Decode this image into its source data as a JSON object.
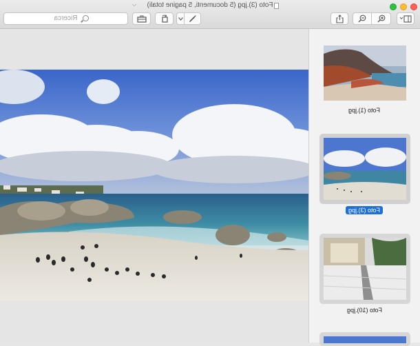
{
  "window": {
    "title": "Foto (3).jpg (5 documenti, 5 pagine totali)"
  },
  "toolbar": {
    "search_placeholder": "Ricerca",
    "icons": [
      "sidebar-icon",
      "zoom-out-icon",
      "zoom-in-icon",
      "share-icon",
      "pen-icon",
      "rotate-icon",
      "toolbox-icon"
    ]
  },
  "sidebar": {
    "items": [
      {
        "label": "Foto (1).jpg",
        "selected": false
      },
      {
        "label": "Foto (3).jpg",
        "selected": true
      },
      {
        "label": "Foto (10).jpg",
        "selected": false
      }
    ]
  },
  "colors": {
    "selection": "#1b6fd6",
    "close": "#fe5f57",
    "minimize": "#fdbc2c",
    "zoom": "#2cc13f"
  }
}
